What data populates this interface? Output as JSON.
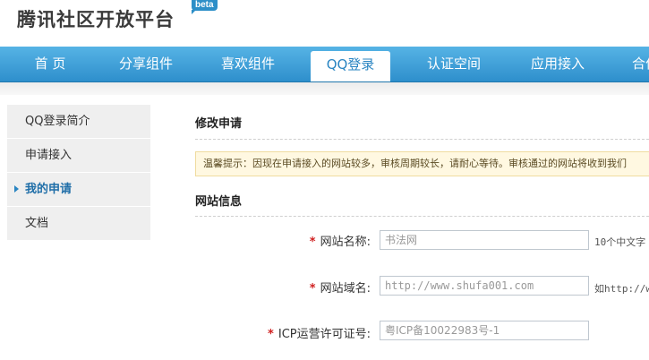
{
  "header": {
    "brand": "腾讯社区开放平台",
    "badge": "beta"
  },
  "nav": {
    "items": [
      {
        "label": "首 页"
      },
      {
        "label": "分享组件"
      },
      {
        "label": "喜欢组件"
      },
      {
        "label": "QQ登录",
        "active": true
      },
      {
        "label": "认证空间"
      },
      {
        "label": "应用接入"
      },
      {
        "label": "合作"
      }
    ]
  },
  "sidebar": {
    "items": [
      {
        "label": "QQ登录简介"
      },
      {
        "label": "申请接入"
      },
      {
        "label": "我的申请",
        "active": true
      },
      {
        "label": "文档"
      }
    ]
  },
  "main": {
    "title": "修改申请",
    "tip": "温馨提示：因现在申请接入的网站较多，审核周期较长，请耐心等待。审核通过的网站将收到我们",
    "section_title": "网站信息",
    "fields": [
      {
        "label": "网站名称:",
        "value": "书法网",
        "hint": "10个中文字"
      },
      {
        "label": "网站域名:",
        "value": "http://www.shufa001.com",
        "hint": "如http://w"
      },
      {
        "label": "ICP运营许可证号:",
        "value": "粤ICP备10022983号-1",
        "hint": ""
      }
    ],
    "required_mark": "*"
  },
  "colors": {
    "nav_top": "#56b3e5",
    "nav_bottom": "#2e8fcc",
    "accent": "#2a85c2",
    "required": "#d02020",
    "tip_bg": "#fff8e1"
  }
}
